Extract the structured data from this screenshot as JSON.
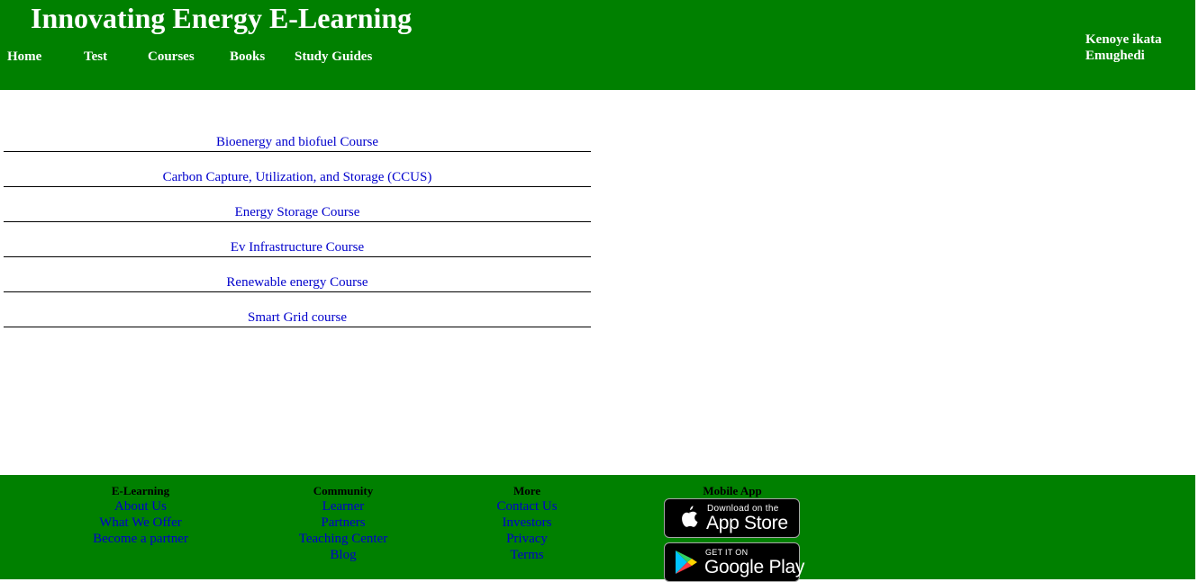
{
  "header": {
    "title": "Innovating Energy E-Learning",
    "nav": [
      "Home",
      "Test",
      "Courses",
      "Books",
      "Study Guides"
    ],
    "user_name": "Kenoye ikata Emughedi"
  },
  "courses": [
    "Bioenergy and biofuel Course",
    "Carbon Capture, Utilization, and Storage (CCUS)",
    "Energy Storage Course",
    "Ev Infrastructure Course",
    "Renewable energy Course",
    "Smart Grid course"
  ],
  "footer": {
    "elearning": {
      "heading": "E-Learning",
      "links": [
        "About Us",
        "What We Offer",
        "Become a partner"
      ]
    },
    "community": {
      "heading": "Community",
      "links": [
        "Learner",
        "Partners",
        "Teaching Center",
        "Blog"
      ]
    },
    "more": {
      "heading": "More",
      "links": [
        "Contact Us",
        "Investors",
        "Privacy",
        "Terms"
      ]
    },
    "mobile_app": {
      "heading": "Mobile App",
      "app_store": {
        "small": "Download on the",
        "big": "App Store"
      },
      "google_play": {
        "small": "GET IT ON",
        "big": "Google Play"
      }
    }
  },
  "colors": {
    "brand_green": "#008000",
    "link_blue": "#0000cc"
  }
}
